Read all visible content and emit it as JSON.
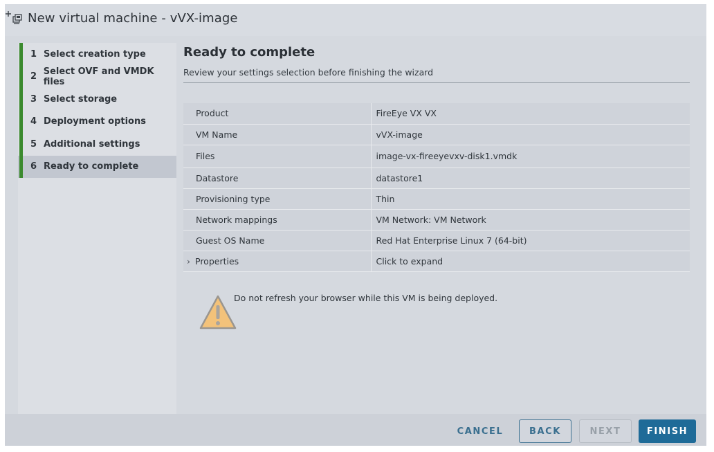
{
  "window": {
    "title": "New virtual machine - vVX-image",
    "icon": "new-vm-icon"
  },
  "steps": [
    {
      "num": "1",
      "label": "Select creation type"
    },
    {
      "num": "2",
      "label": "Select OVF and VMDK files"
    },
    {
      "num": "3",
      "label": "Select storage"
    },
    {
      "num": "4",
      "label": "Deployment options"
    },
    {
      "num": "5",
      "label": "Additional settings"
    },
    {
      "num": "6",
      "label": "Ready to complete"
    }
  ],
  "active_step": 6,
  "main": {
    "heading": "Ready to complete",
    "subheading": "Review your settings selection before finishing the wizard",
    "rows": [
      {
        "key": "Product",
        "value": "FireEye VX VX"
      },
      {
        "key": "VM Name",
        "value": "vVX-image"
      },
      {
        "key": "Files",
        "value": "image-vx-fireeyevxv-disk1.vmdk"
      },
      {
        "key": "Datastore",
        "value": "datastore1"
      },
      {
        "key": "Provisioning type",
        "value": "Thin"
      },
      {
        "key": "Network mappings",
        "value": "VM Network: VM Network"
      },
      {
        "key": "Guest OS Name",
        "value": "Red Hat Enterprise Linux 7 (64-bit)"
      },
      {
        "key": "Properties",
        "value": "Click to expand"
      }
    ],
    "warning": "Do not refresh your browser while this VM is being deployed."
  },
  "footer": {
    "cancel": "CANCEL",
    "back": "BACK",
    "next": "NEXT",
    "finish": "FINISH"
  },
  "colors": {
    "accent": "#1f6b98",
    "step_bar": "#3b8a2e",
    "warning": "#f3c27a"
  }
}
